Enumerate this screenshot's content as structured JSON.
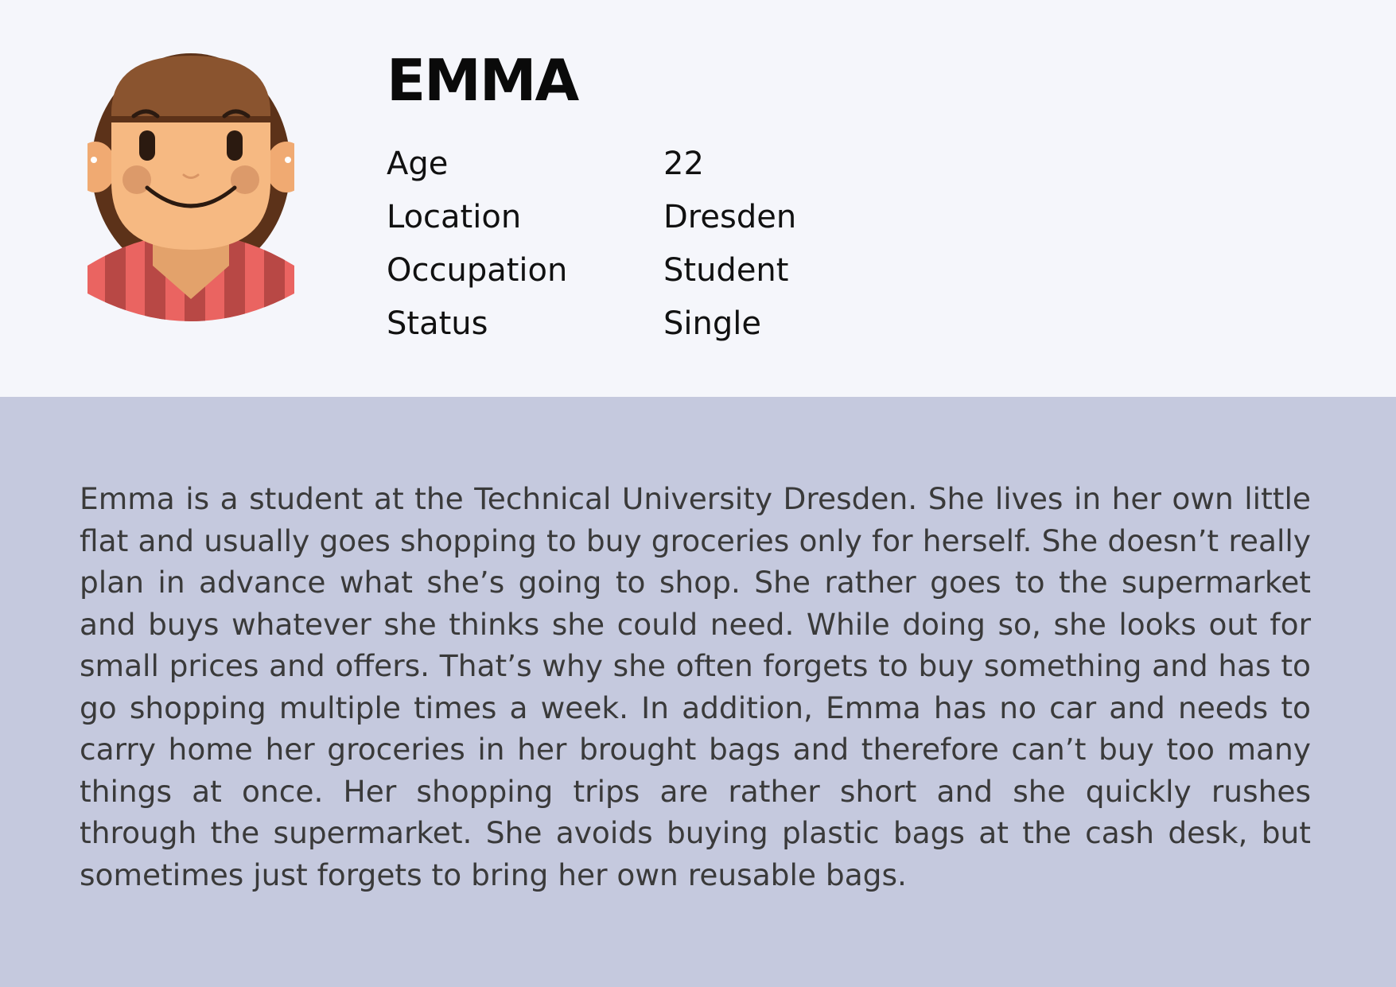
{
  "persona": {
    "name": "EMMA",
    "facts": [
      {
        "label": "Age",
        "value": "22"
      },
      {
        "label": "Location",
        "value": "Dresden"
      },
      {
        "label": "Occupation",
        "value": "Student"
      },
      {
        "label": "Status",
        "value": "Single"
      }
    ],
    "bio": "Emma is a student at the Technical University Dresden. She lives in her own little flat and usually goes shopping to buy groceries only for herself. She doesn’t really plan in advance what she’s going to shop. She rather goes to the supermarket and buys whatever she thinks she could need. While doing so, she looks out for small prices and offers. That’s why she often forgets to buy something and has to go shopping multiple times a week. In addition, Emma has no car and needs to carry home her groceries in her brought bags and therefore can’t buy too many things at once. Her shopping trips are rather short and she quickly rushes through the supermarket. She avoids buying plastic bags at the cash desk, but sometimes just forgets to bring her own reusable bags."
  },
  "colors": {
    "top_background": "#f5f6fb",
    "bottom_background": "#c5c9de",
    "hair": "#6b3a1f",
    "skin": "#f6b982",
    "shirt_light": "#ea6461",
    "shirt_dark": "#b84845"
  },
  "icons": {
    "avatar": "woman-avatar-icon"
  }
}
